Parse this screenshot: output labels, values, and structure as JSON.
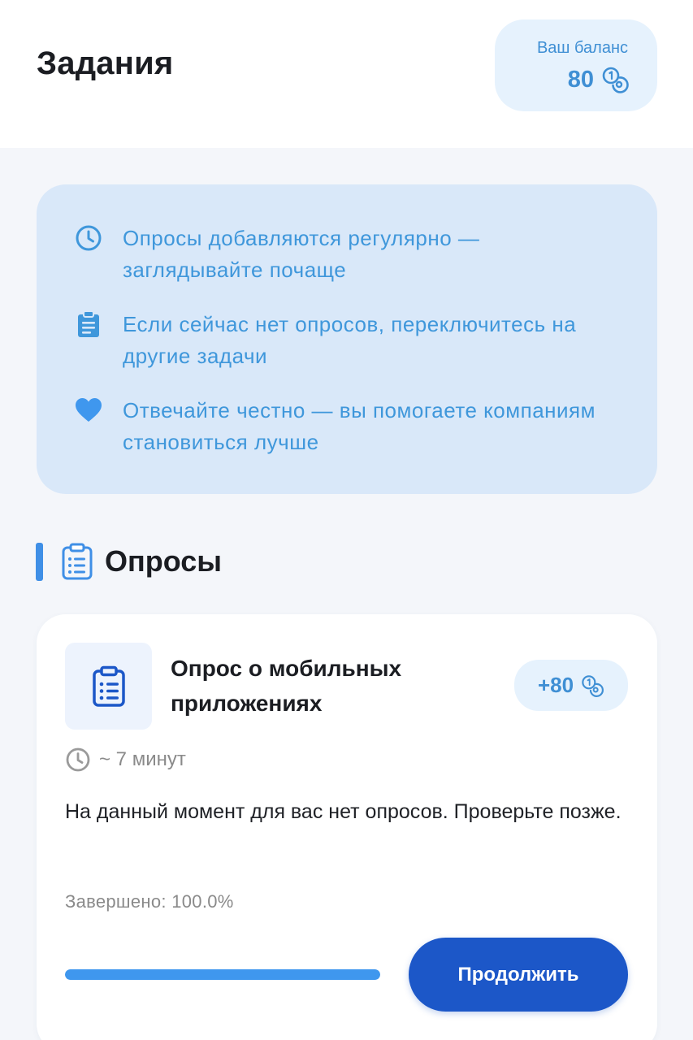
{
  "header": {
    "title": "Задания",
    "balance": {
      "label": "Ваш баланс",
      "value": "80",
      "icon": "coins-icon"
    }
  },
  "info": {
    "tips": [
      {
        "icon": "clock-icon",
        "text": "Опросы добавляются регулярно — заглядывайте почаще"
      },
      {
        "icon": "clipboard-icon",
        "text": "Если сейчас нет опросов, переключитесь на другие задачи"
      },
      {
        "icon": "heart-icon",
        "text": "Отвечайте честно — вы помогаете компаниям становиться лучше"
      }
    ]
  },
  "section": {
    "title": "Опросы",
    "icon": "clipboard-list-icon"
  },
  "survey": {
    "title": "Опрос о мобильных приложениях",
    "reward": "+80",
    "duration": "~ 7 минут",
    "message": "На данный момент для вас нет опросов. Проверьте позже.",
    "completed": "Завершено: 100.0%",
    "progress": 1.0,
    "button_label": "Продолжить"
  },
  "colors": {
    "accent": "#3f8fd4",
    "info_text": "#3f97db",
    "button": "#1c57c8",
    "progress": "#3f97ee"
  }
}
